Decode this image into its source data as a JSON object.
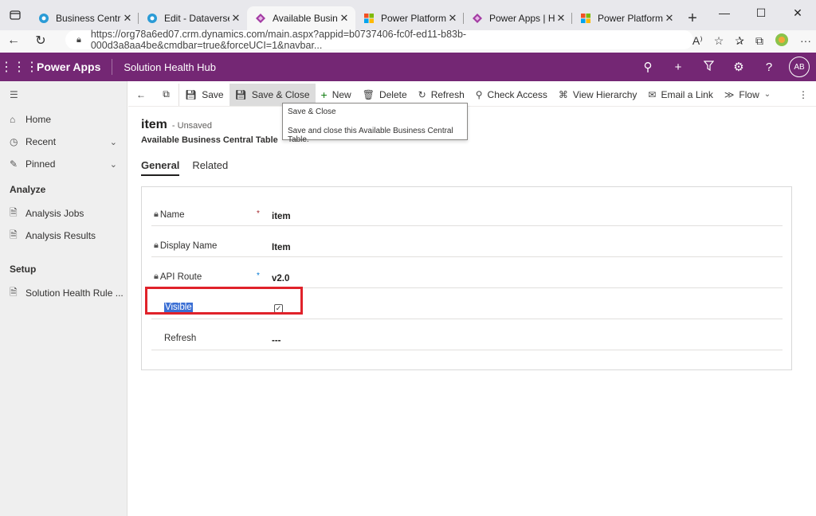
{
  "browser": {
    "tabs": [
      {
        "title": "Business Central Adm",
        "favicon": "dataverse-icon",
        "active": false
      },
      {
        "title": "Edit - Dataverse Con",
        "favicon": "dataverse-icon",
        "active": false
      },
      {
        "title": "Available Business Ce",
        "favicon": "powerapps-icon",
        "active": true
      },
      {
        "title": "Power Platform adm",
        "favicon": "microsoft-icon",
        "active": false
      },
      {
        "title": "Power Apps | Home",
        "favicon": "powerapps-icon",
        "active": false
      },
      {
        "title": "Power Platform adm",
        "favicon": "microsoft-icon",
        "active": false
      }
    ],
    "url": "https://org78a6ed07.crm.dynamics.com/main.aspx?appid=b0737406-fc0f-ed11-b83b-000d3a8aa4be&cmdbar=true&forceUCI=1&navbar..."
  },
  "appbar": {
    "app_name": "Power Apps",
    "solution_name": "Solution Health Hub",
    "avatar_initials": "AB",
    "brand_color": "#742774"
  },
  "leftnav": {
    "items": [
      {
        "label": "Home",
        "icon": "home-icon"
      },
      {
        "label": "Recent",
        "icon": "clock-icon"
      },
      {
        "label": "Pinned",
        "icon": "pin-icon"
      }
    ],
    "sections": [
      {
        "title": "Analyze",
        "items": [
          {
            "label": "Analysis Jobs"
          },
          {
            "label": "Analysis Results"
          }
        ]
      },
      {
        "title": "Setup",
        "items": [
          {
            "label": "Solution Health Rule ..."
          }
        ]
      }
    ]
  },
  "commandbar": {
    "save": "Save",
    "save_close": "Save & Close",
    "new": "New",
    "delete": "Delete",
    "refresh": "Refresh",
    "check_access": "Check Access",
    "view_hierarchy": "View Hierarchy",
    "email_link": "Email a Link",
    "flow": "Flow"
  },
  "tooltip": {
    "title": "Save & Close",
    "description": "Save and close this Available Business Central Table."
  },
  "record": {
    "name": "item",
    "status": "- Unsaved",
    "entity": "Available Business Central Table"
  },
  "form_tabs": [
    "General",
    "Related"
  ],
  "fields": {
    "name": {
      "label": "Name",
      "value": "item"
    },
    "display_name": {
      "label": "Display Name",
      "value": "Item"
    },
    "api_route": {
      "label": "API Route",
      "value": "v2.0"
    },
    "visible": {
      "label": "Visible",
      "checked": true
    },
    "refresh": {
      "label": "Refresh",
      "value": "---"
    }
  }
}
